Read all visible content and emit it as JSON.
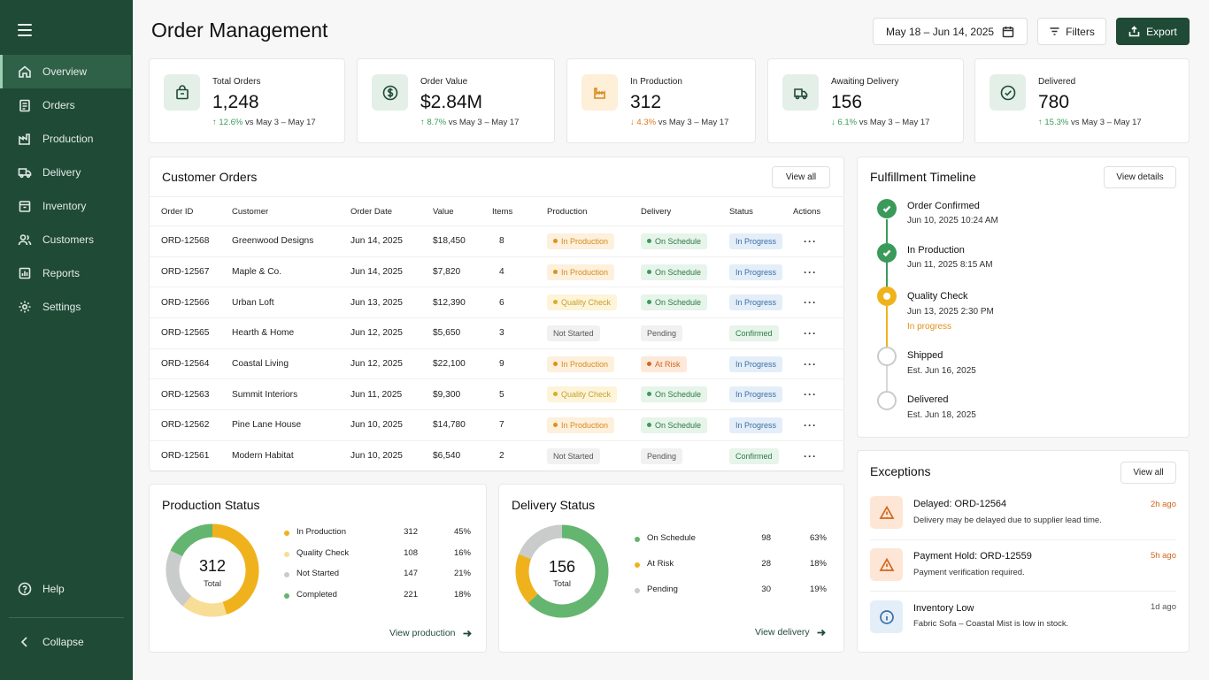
{
  "sidebar": {
    "items": [
      {
        "label": "Overview",
        "icon": "home-icon",
        "active": true
      },
      {
        "label": "Orders",
        "icon": "clipboard-icon"
      },
      {
        "label": "Production",
        "icon": "factory-icon"
      },
      {
        "label": "Delivery",
        "icon": "truck-icon"
      },
      {
        "label": "Inventory",
        "icon": "box-icon"
      },
      {
        "label": "Customers",
        "icon": "users-icon"
      },
      {
        "label": "Reports",
        "icon": "bar-chart-icon"
      },
      {
        "label": "Settings",
        "icon": "gear-icon"
      }
    ],
    "help_label": "Help",
    "collapse_label": "Collapse"
  },
  "header": {
    "title": "Order Management",
    "date_range": "May 18 – Jun 14, 2025",
    "filters_label": "Filters",
    "export_label": "Export"
  },
  "kpis": [
    {
      "label": "Total Orders",
      "value": "1,248",
      "delta": "12.6%",
      "dir": "up",
      "compare": "vs May 3 – May 17",
      "icon": "shopping-bag-icon"
    },
    {
      "label": "Order Value",
      "value": "$2.84M",
      "delta": "8.7%",
      "dir": "up",
      "compare": "vs May 3 – May 17",
      "icon": "dollar-icon"
    },
    {
      "label": "In Production",
      "value": "312",
      "delta": "4.3%",
      "dir": "down",
      "compare": "vs May 3 – May 17",
      "icon": "factory-icon"
    },
    {
      "label": "Awaiting Delivery",
      "value": "156",
      "delta": "6.1%",
      "dir": "down",
      "compare": "vs May 3 – May 17",
      "icon": "truck-icon"
    },
    {
      "label": "Delivered",
      "value": "780",
      "delta": "15.3%",
      "dir": "up",
      "compare": "vs May 3 – May 17",
      "icon": "check-circle-icon"
    }
  ],
  "orders": {
    "title": "Customer Orders",
    "view_all": "View all",
    "columns": [
      "Order ID",
      "Customer",
      "Order Date",
      "Value",
      "Items",
      "Production",
      "Delivery",
      "Status",
      "Actions"
    ],
    "rows": [
      {
        "id": "ORD-12568",
        "customer": "Greenwood Designs",
        "date": "Jun 14, 2025",
        "value": "$18,450",
        "items": "8",
        "production": "In Production",
        "delivery": "On Schedule",
        "status": "In Progress"
      },
      {
        "id": "ORD-12567",
        "customer": "Maple & Co.",
        "date": "Jun 14, 2025",
        "value": "$7,820",
        "items": "4",
        "production": "In Production",
        "delivery": "On Schedule",
        "status": "In Progress"
      },
      {
        "id": "ORD-12566",
        "customer": "Urban Loft",
        "date": "Jun 13, 2025",
        "value": "$12,390",
        "items": "6",
        "production": "Quality Check",
        "delivery": "On Schedule",
        "status": "In Progress"
      },
      {
        "id": "ORD-12565",
        "customer": "Hearth & Home",
        "date": "Jun 12, 2025",
        "value": "$5,650",
        "items": "3",
        "production": "Not Started",
        "delivery": "Pending",
        "status": "Confirmed"
      },
      {
        "id": "ORD-12564",
        "customer": "Coastal Living",
        "date": "Jun 12, 2025",
        "value": "$22,100",
        "items": "9",
        "production": "In Production",
        "delivery": "At Risk",
        "status": "In Progress"
      },
      {
        "id": "ORD-12563",
        "customer": "Summit Interiors",
        "date": "Jun 11, 2025",
        "value": "$9,300",
        "items": "5",
        "production": "Quality Check",
        "delivery": "On Schedule",
        "status": "In Progress"
      },
      {
        "id": "ORD-12562",
        "customer": "Pine Lane House",
        "date": "Jun 10, 2025",
        "value": "$14,780",
        "items": "7",
        "production": "In Production",
        "delivery": "On Schedule",
        "status": "In Progress"
      },
      {
        "id": "ORD-12561",
        "customer": "Modern Habitat",
        "date": "Jun 10, 2025",
        "value": "$6,540",
        "items": "2",
        "production": "Not Started",
        "delivery": "Pending",
        "status": "Confirmed"
      }
    ]
  },
  "timeline": {
    "title": "Fulfillment Timeline",
    "view_details": "View details",
    "steps": [
      {
        "title": "Order Confirmed",
        "sub": "Jun 10, 2025 10:24 AM",
        "state": "done"
      },
      {
        "title": "In Production",
        "sub": "Jun 11, 2025 8:15 AM",
        "state": "done"
      },
      {
        "title": "Quality Check",
        "sub": "Jun 13, 2025 2:30 PM",
        "state": "current",
        "note": "In progress"
      },
      {
        "title": "Shipped",
        "sub": "Est. Jun 16, 2025",
        "state": "pending"
      },
      {
        "title": "Delivered",
        "sub": "Est. Jun 18, 2025",
        "state": "pending"
      }
    ]
  },
  "exceptions": {
    "title": "Exceptions",
    "view_all": "View all",
    "items": [
      {
        "title": "Delayed: ORD-12564",
        "desc": "Delivery may be delayed due to supplier lead time.",
        "time": "2h ago",
        "icon": "warning-icon"
      },
      {
        "title": "Payment Hold: ORD-12559",
        "desc": "Payment verification required.",
        "time": "5h ago",
        "icon": "warning-icon"
      },
      {
        "title": "Inventory Low",
        "desc": "Fabric Sofa – Coastal Mist is low in stock.",
        "time": "1d ago",
        "icon": "info-icon"
      }
    ]
  },
  "production_status": {
    "title": "Production Status",
    "center_value": "312",
    "center_label": "Total",
    "link": "View production",
    "items": [
      {
        "name": "In Production",
        "value": "312",
        "pct": "45%",
        "color": "#f0b21c"
      },
      {
        "name": "Quality Check",
        "value": "108",
        "pct": "16%",
        "color": "#f7dd96"
      },
      {
        "name": "Not Started",
        "value": "147",
        "pct": "21%",
        "color": "#c9cccb"
      },
      {
        "name": "Completed",
        "value": "221",
        "pct": "18%",
        "color": "#64b56f"
      }
    ]
  },
  "delivery_status": {
    "title": "Delivery Status",
    "center_value": "156",
    "center_label": "Total",
    "link": "View delivery",
    "items": [
      {
        "name": "On Schedule",
        "value": "98",
        "pct": "63%",
        "color": "#64b56f"
      },
      {
        "name": "At Risk",
        "value": "28",
        "pct": "18%",
        "color": "#f0b21c"
      },
      {
        "name": "Pending",
        "value": "30",
        "pct": "19%",
        "color": "#c9cccb"
      }
    ]
  },
  "chart_data": [
    {
      "type": "pie",
      "title": "Production Status",
      "categories": [
        "In Production",
        "Quality Check",
        "Not Started",
        "Completed"
      ],
      "values": [
        45,
        16,
        21,
        18
      ]
    },
    {
      "type": "pie",
      "title": "Delivery Status",
      "categories": [
        "On Schedule",
        "At Risk",
        "Pending"
      ],
      "values": [
        63,
        18,
        19
      ]
    }
  ],
  "colors": {
    "brand": "#1f4a36",
    "accent": "#f0b21c",
    "success": "#64b56f"
  }
}
